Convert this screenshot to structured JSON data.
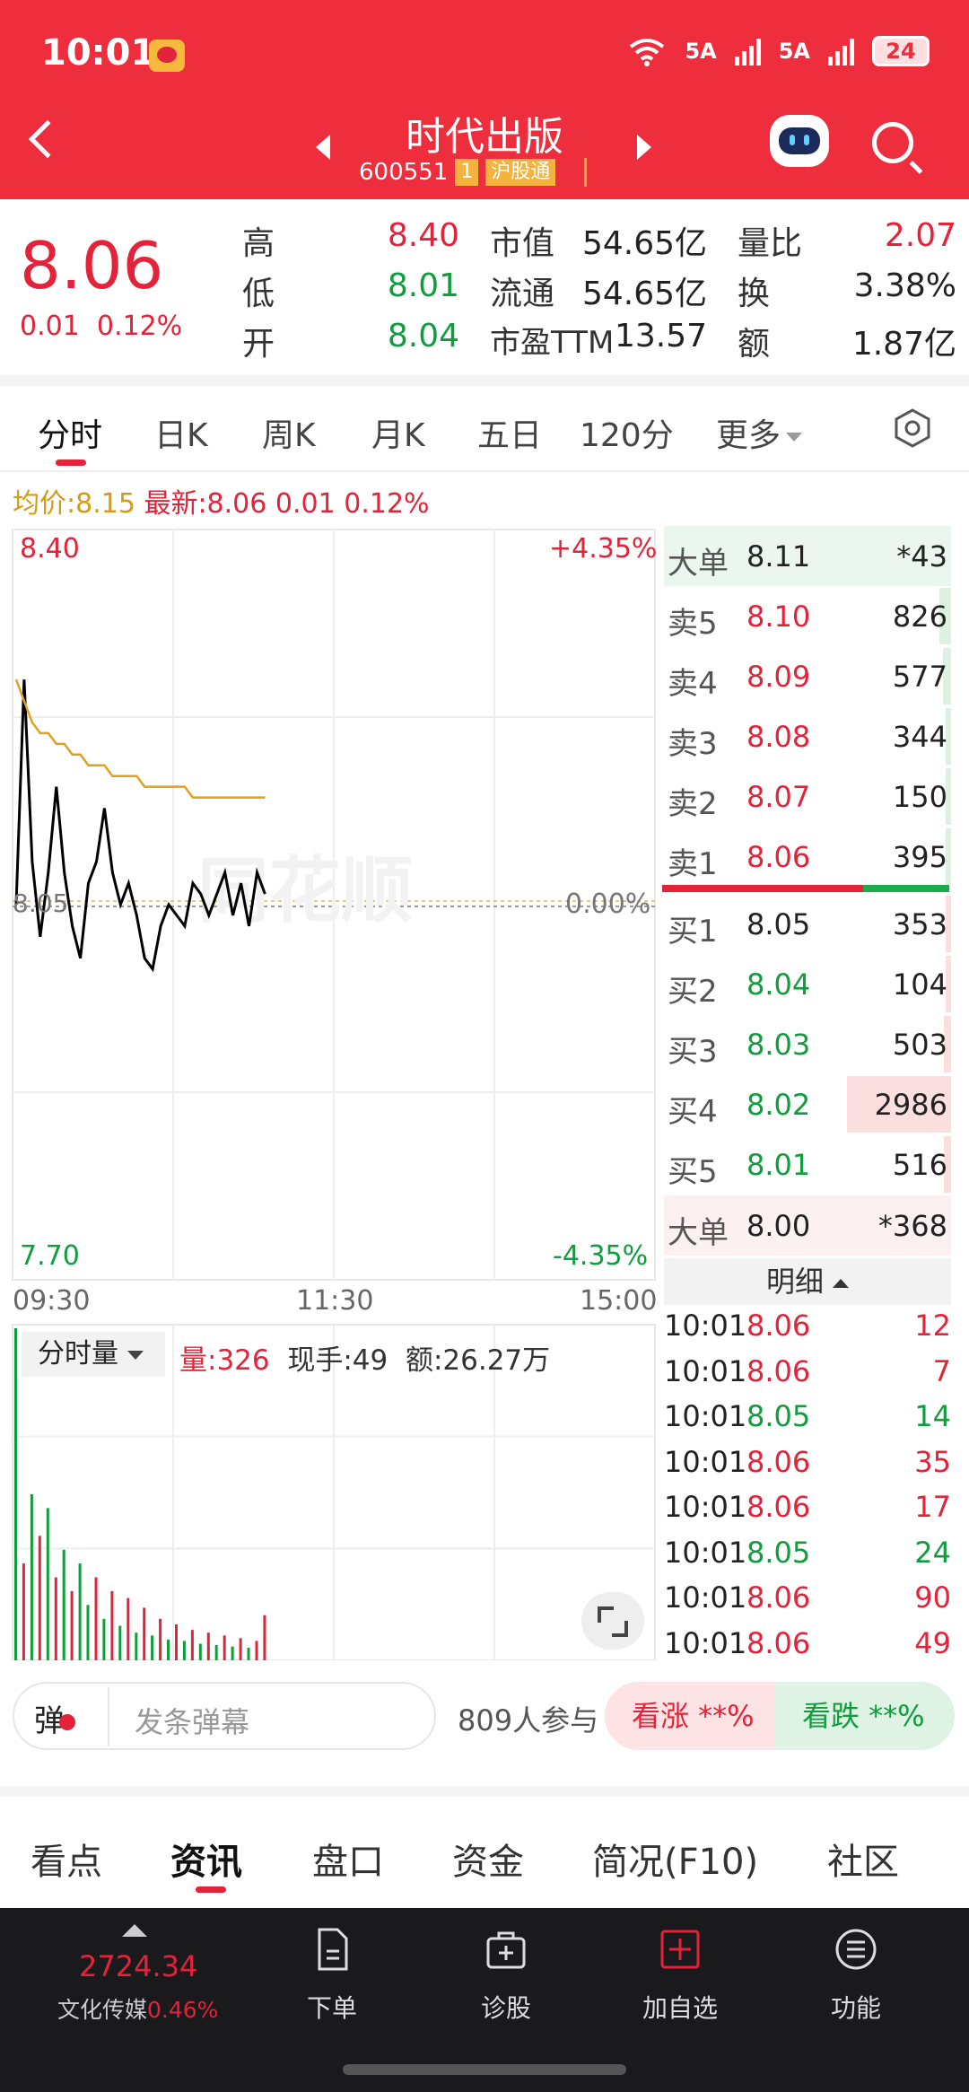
{
  "status_bar": {
    "time": "10:01",
    "signal1": "5A",
    "signal2": "5A",
    "battery": "24"
  },
  "header": {
    "stock_name": "时代出版",
    "stock_code": "600551",
    "rank_tag": "1",
    "market_tag": "沪股通"
  },
  "quote": {
    "price": "8.06",
    "change": "0.01",
    "change_pct": "0.12%",
    "high_label": "高",
    "high": "8.40",
    "low_label": "低",
    "low": "8.01",
    "open_label": "开",
    "open": "8.04",
    "mcap_label": "市值",
    "mcap": "54.65亿",
    "float_label": "流通",
    "float_cap": "54.65亿",
    "pe_label": "市盈TTM",
    "pe": "13.57",
    "vol_ratio_label": "量比",
    "vol_ratio": "2.07",
    "turnover_label": "换",
    "turnover": "3.38%",
    "amount_label": "额",
    "amount": "1.87亿"
  },
  "tabs": [
    "分时",
    "日K",
    "周K",
    "月K",
    "五日",
    "120分",
    "更多"
  ],
  "avg_line": {
    "avg_label": "均价:8.15",
    "latest_label": "最新:8.06",
    "change": "0.01",
    "change_pct": "0.12%"
  },
  "chart": {
    "y_top": "8.40",
    "y_mid": "8.05",
    "y_bottom": "7.70",
    "pct_top": "+4.35%",
    "pct_mid": "0.00%",
    "pct_bottom": "-4.35%",
    "x_labels": [
      "09:30",
      "11:30",
      "15:00"
    ],
    "watermark": "同花顺"
  },
  "chart_data": {
    "type": "line",
    "x": [
      "09:30",
      "09:31",
      "09:32",
      "09:33",
      "09:34",
      "09:35",
      "09:36",
      "09:37",
      "09:38",
      "09:39",
      "09:40",
      "09:41",
      "09:42",
      "09:43",
      "09:44",
      "09:45",
      "09:46",
      "09:47",
      "09:48",
      "09:49",
      "09:50",
      "09:51",
      "09:52",
      "09:53",
      "09:54",
      "09:55",
      "09:56",
      "09:57",
      "09:58",
      "09:59",
      "10:00",
      "10:01"
    ],
    "series": [
      {
        "values": [
          8.05,
          8.26,
          8.09,
          8.02,
          8.08,
          8.16,
          8.08,
          8.03,
          8.0,
          8.07,
          8.09,
          8.14,
          8.08,
          8.05,
          8.07,
          8.04,
          8.0,
          7.99,
          8.03,
          8.05,
          8.04,
          8.03,
          8.07,
          8.06,
          8.04,
          8.06,
          8.08,
          8.04,
          8.07,
          8.03,
          8.08,
          8.06
        ]
      },
      {
        "values": [
          8.26,
          8.24,
          8.22,
          8.21,
          8.21,
          8.2,
          8.2,
          8.19,
          8.19,
          8.18,
          8.18,
          8.18,
          8.17,
          8.17,
          8.17,
          8.17,
          8.16,
          8.16,
          8.16,
          8.16,
          8.16,
          8.16,
          8.15,
          8.15,
          8.15,
          8.15,
          8.15,
          8.15,
          8.15,
          8.15,
          8.15,
          8.15
        ]
      }
    ],
    "ylim": [
      7.7,
      8.4
    ],
    "volume": [
      2400,
      700,
      1200,
      900,
      1100,
      600,
      800,
      500,
      700,
      400,
      600,
      300,
      500,
      250,
      450,
      200,
      380,
      180,
      300,
      150,
      260,
      140,
      220,
      120,
      200,
      110,
      180,
      100,
      160,
      90,
      140,
      326
    ],
    "volume_colors": [
      "#0f9d3d",
      "#e2233a",
      "#0f9d3d",
      "#e2233a",
      "#0f9d3d",
      "#e2233a",
      "#0f9d3d",
      "#e2233a",
      "#0f9d3d",
      "#0f9d3d",
      "#e2233a",
      "#0f9d3d",
      "#e2233a",
      "#0f9d3d",
      "#e2233a",
      "#0f9d3d",
      "#e2233a",
      "#0f9d3d",
      "#e2233a",
      "#0f9d3d",
      "#e2233a",
      "#0f9d3d",
      "#e2233a",
      "#0f9d3d",
      "#e2233a",
      "#0f9d3d",
      "#e2233a",
      "#0f9d3d",
      "#e2233a",
      "#0f9d3d",
      "#e2233a",
      "#e2233a"
    ],
    "colors": {
      "price": "#000000",
      "avg": "#e0a020"
    }
  },
  "order_book": {
    "big_sell": {
      "label": "大单",
      "price": "8.11",
      "qty": "*43"
    },
    "asks": [
      {
        "label": "卖5",
        "price": "8.10",
        "qty": "826",
        "level": 0.11
      },
      {
        "label": "卖4",
        "price": "8.09",
        "qty": "577",
        "level": 0.08
      },
      {
        "label": "卖3",
        "price": "8.08",
        "qty": "344",
        "level": 0.05
      },
      {
        "label": "卖2",
        "price": "8.07",
        "qty": "150",
        "level": 0.02
      },
      {
        "label": "卖1",
        "price": "8.06",
        "qty": "395",
        "level": 0.05
      }
    ],
    "bids": [
      {
        "label": "买1",
        "price": "8.05",
        "qty": "353",
        "level": 0.05
      },
      {
        "label": "买2",
        "price": "8.04",
        "qty": "104",
        "level": 0.02
      },
      {
        "label": "买3",
        "price": "8.03",
        "qty": "503",
        "level": 0.07
      },
      {
        "label": "买4",
        "price": "8.02",
        "qty": "2986",
        "level": 1.0
      },
      {
        "label": "买5",
        "price": "8.01",
        "qty": "516",
        "level": 0.07
      }
    ],
    "big_buy": {
      "label": "大单",
      "price": "8.00",
      "qty": "*368"
    },
    "detail_label": "明细"
  },
  "ticks": [
    {
      "time": "10:01",
      "price": "8.06",
      "vol": "12",
      "dir": "red"
    },
    {
      "time": "10:01",
      "price": "8.06",
      "vol": "7",
      "dir": "red"
    },
    {
      "time": "10:01",
      "price": "8.05",
      "vol": "14",
      "dir": "green"
    },
    {
      "time": "10:01",
      "price": "8.06",
      "vol": "35",
      "dir": "red"
    },
    {
      "time": "10:01",
      "price": "8.06",
      "vol": "17",
      "dir": "red"
    },
    {
      "time": "10:01",
      "price": "8.05",
      "vol": "24",
      "dir": "green"
    },
    {
      "time": "10:01",
      "price": "8.06",
      "vol": "90",
      "dir": "red"
    },
    {
      "time": "10:01",
      "price": "8.06",
      "vol": "49",
      "dir": "red"
    }
  ],
  "volume_panel": {
    "selector": "分时量",
    "vol": "量:326",
    "now": "现手:49",
    "amount": "额:26.27万"
  },
  "danmu": {
    "icon_text": "弹",
    "placeholder": "发条弹幕",
    "participants": "809人参与",
    "bull": "看涨 **%",
    "bear": "看跌 **%"
  },
  "info_tabs": [
    "看点",
    "资讯",
    "盘口",
    "资金",
    "简况(F10)",
    "社区"
  ],
  "bottom_bar": {
    "index_value": "2724.34",
    "index_name": "文化传媒",
    "index_pct": "0.46%",
    "items": [
      "下单",
      "诊股",
      "加自选",
      "功能"
    ]
  }
}
